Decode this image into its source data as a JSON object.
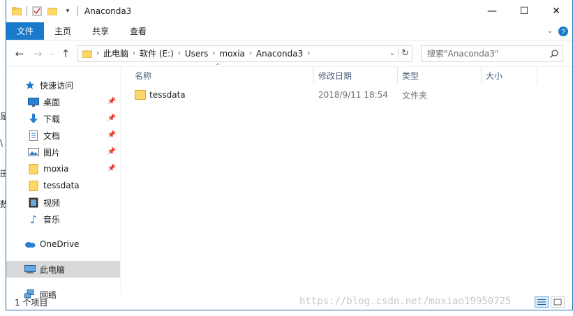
{
  "window": {
    "title": "Anaconda3",
    "controls": [
      "minimize",
      "maximize",
      "close"
    ]
  },
  "ribbon": {
    "tabs": [
      {
        "label": "文件",
        "active": true
      },
      {
        "label": "主页",
        "active": false
      },
      {
        "label": "共享",
        "active": false
      },
      {
        "label": "查看",
        "active": false
      }
    ]
  },
  "address": {
    "breadcrumbs": [
      "此电脑",
      "软件 (E:)",
      "Users",
      "moxia",
      "Anaconda3"
    ]
  },
  "search": {
    "placeholder": "搜索\"Anaconda3\""
  },
  "nav": {
    "quick_access": "快速访问",
    "items": [
      {
        "label": "桌面",
        "icon": "desktop-icon",
        "pinned": true
      },
      {
        "label": "下载",
        "icon": "download-icon",
        "pinned": true
      },
      {
        "label": "文档",
        "icon": "document-icon",
        "pinned": true
      },
      {
        "label": "图片",
        "icon": "picture-icon",
        "pinned": true
      },
      {
        "label": "moxia",
        "icon": "folder-icon",
        "pinned": true
      },
      {
        "label": "tessdata",
        "icon": "folder-icon",
        "pinned": false
      },
      {
        "label": "视频",
        "icon": "video-icon",
        "pinned": false
      },
      {
        "label": "音乐",
        "icon": "music-icon",
        "pinned": false
      }
    ],
    "onedrive": "OneDrive",
    "this_pc": "此电脑",
    "network": "网络"
  },
  "columns": {
    "name": "名称",
    "modified": "修改日期",
    "type": "类型",
    "size": "大小"
  },
  "files": [
    {
      "name": "tessdata",
      "modified": "2018/9/11 18:54",
      "type": "文件夹",
      "size": ""
    }
  ],
  "status": {
    "item_count": "1 个项目",
    "watermark": "https://blog.csdn.net/moxiao19950725"
  },
  "colors": {
    "accent": "#1979ca",
    "selected": "#d9d9d9",
    "folder": "#ffd766"
  }
}
